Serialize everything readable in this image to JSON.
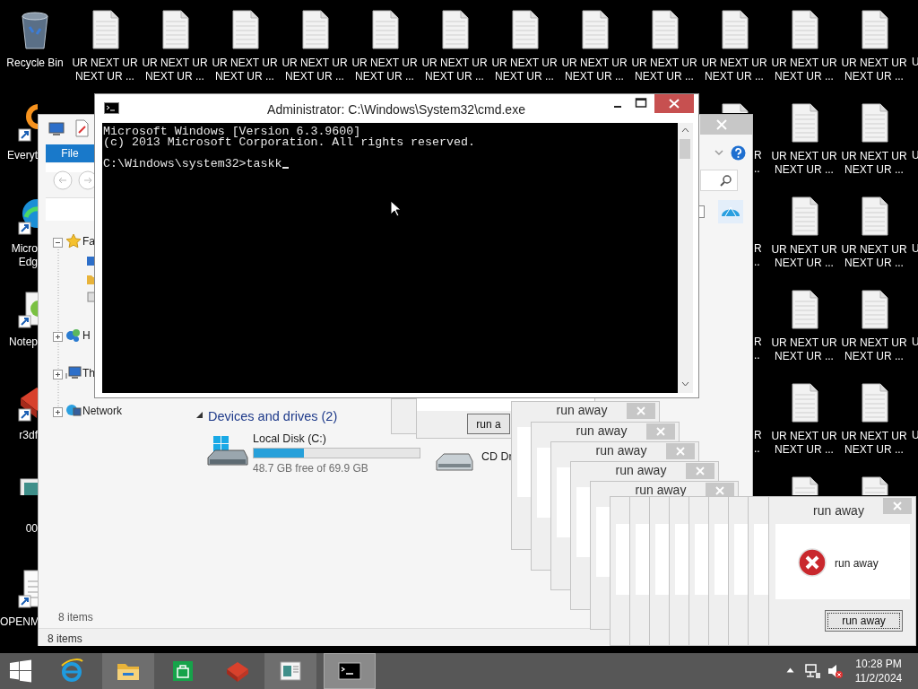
{
  "desktop_icons": [
    {
      "kind": "recycle-bin",
      "label": "Recycle Bin"
    },
    {
      "kind": "ring-app",
      "label": "Everyt"
    },
    {
      "kind": "browser",
      "label": "Micro Edg"
    },
    {
      "kind": "editor",
      "label": "Notep"
    },
    {
      "kind": "red-app",
      "label": "r3df"
    },
    {
      "kind": "picture",
      "label": "00"
    },
    {
      "kind": "document",
      "label": "OPENM"
    },
    {
      "kind": "text-file",
      "label": "UR NEXT UR NEXT UR ..."
    },
    {
      "kind": "text-file",
      "label": "UR NEXT UR NEXT UR ..."
    },
    {
      "kind": "text-file",
      "label": "UR NEXT UR NEXT UR ..."
    },
    {
      "kind": "text-file",
      "label": "UR NEXT UR NEXT UR ..."
    },
    {
      "kind": "text-file",
      "label": "UR NEXT UR NEXT UR ..."
    },
    {
      "kind": "text-file",
      "label": "UR NEXT UR NEXT UR ..."
    },
    {
      "kind": "text-file",
      "label": "UR NEXT UR NEXT UR ..."
    },
    {
      "kind": "text-file",
      "label": "UR NEXT UR NEXT UR ..."
    },
    {
      "kind": "text-file",
      "label": "UR NEXT UR NEXT UR ..."
    },
    {
      "kind": "text-file",
      "label": "UR NEXT UR NEXT UR ..."
    },
    {
      "kind": "text-file",
      "label": "R .."
    },
    {
      "kind": "text-file",
      "label": "R .."
    },
    {
      "kind": "text-file",
      "label": "R .."
    },
    {
      "kind": "text-file",
      "label": "R .."
    },
    {
      "kind": "text-file",
      "label": "UR NEXT UR NEXT UR ..."
    },
    {
      "kind": "text-file",
      "label": "UR NEXT UR NEXT UR ..."
    },
    {
      "kind": "text-file",
      "label": "UR NEXT UR NEXT UR ..."
    },
    {
      "kind": "text-file",
      "label": "UR NEXT UR NEXT UR ..."
    },
    {
      "kind": "text-file",
      "label": "UR NEXT UR NEXT UR ..."
    },
    {
      "kind": "text-file"
    },
    {
      "kind": "text-file",
      "label": "UR NEXT UR NEXT UR ..."
    },
    {
      "kind": "text-file",
      "label": "UR NEXT UR NEXT UR ..."
    },
    {
      "kind": "text-file",
      "label": "UR NEXT UR NEXT UR ..."
    },
    {
      "kind": "text-file",
      "label": "UR NEXT UR NEXT UR ..."
    },
    {
      "kind": "text-file",
      "label": "UR NEXT UR NEXT UR ..."
    },
    {
      "kind": "text-file"
    },
    {
      "kind": "text-file",
      "label": "U"
    },
    {
      "kind": "text-file",
      "label": "U"
    },
    {
      "kind": "text-file",
      "label": "U"
    },
    {
      "kind": "text-file",
      "label": "U"
    },
    {
      "kind": "text-file",
      "label": "U"
    }
  ],
  "explorer": {
    "file_tab": "File",
    "tree": [
      {
        "kind": "favorites",
        "label": "Fa",
        "expanded": true,
        "children": [
          {
            "kind": "desktop"
          },
          {
            "kind": "downloads"
          },
          {
            "kind": "places"
          }
        ]
      },
      {
        "kind": "homegroup",
        "label": "H",
        "expanded": false
      },
      {
        "kind": "computer",
        "label": "Th",
        "expanded": false
      },
      {
        "kind": "network",
        "label": "Network",
        "expanded": false
      }
    ],
    "section": {
      "title": "Devices and drives (2)",
      "expanded": true
    },
    "drives": [
      {
        "kind": "hdd",
        "name": "Local Disk (C:)",
        "level": 0.3,
        "free": "48.7 GB free of 69.9 GB"
      },
      {
        "kind": "cd",
        "name": "CD Dr"
      }
    ],
    "content_status": "8 items",
    "status_bar": "8 items"
  },
  "console": {
    "title": "Administrator: C:\\Windows\\System32\\cmd.exe",
    "lines": [
      "Microsoft Windows [Version 6.3.9600]",
      "(c) 2013 Microsoft Corporation. All rights reserved."
    ],
    "prompt": "C:\\Windows\\system32>taskk"
  },
  "dialogs": [
    {
      "kind": "covered"
    },
    {
      "kind": "button-only",
      "button": "run a"
    },
    {
      "kind": "titled",
      "title": "run away"
    },
    {
      "kind": "titled",
      "title": "run away"
    },
    {
      "kind": "titled",
      "title": "run away"
    },
    {
      "kind": "titled",
      "title": "run away"
    },
    {
      "kind": "titled",
      "title": "run away"
    },
    {
      "kind": "covered"
    },
    {
      "kind": "covered"
    },
    {
      "kind": "covered"
    },
    {
      "kind": "covered"
    },
    {
      "kind": "covered"
    },
    {
      "kind": "covered"
    },
    {
      "kind": "covered"
    },
    {
      "kind": "covered"
    },
    {
      "kind": "message",
      "title": "run away",
      "message": "run away",
      "button": "run away"
    }
  ],
  "taskbar": {
    "items": [
      {
        "kind": "start",
        "running": false,
        "active": false
      },
      {
        "kind": "browser",
        "running": false,
        "active": false
      },
      {
        "kind": "folder",
        "running": true,
        "active": false
      },
      {
        "kind": "store",
        "running": false,
        "active": false
      },
      {
        "kind": "red-app",
        "running": false,
        "active": false
      },
      {
        "kind": "viewer",
        "running": true,
        "active": false
      },
      {
        "kind": "terminal",
        "running": true,
        "active": true
      }
    ],
    "time": "10:28 PM",
    "date": "11/2/2024"
  }
}
